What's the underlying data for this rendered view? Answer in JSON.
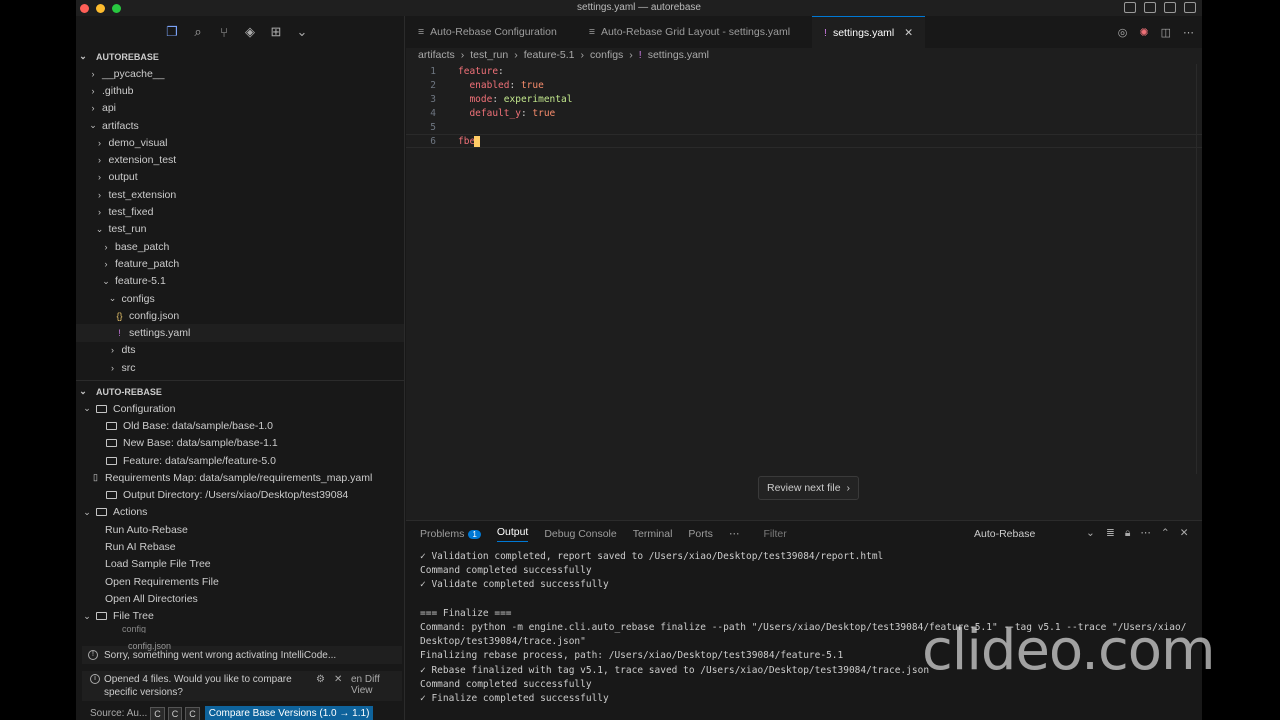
{
  "window": {
    "title": "settings.yaml — autorebase"
  },
  "explorer": {
    "section_title": "AUTOREBASE",
    "tree": [
      {
        "label": "__pycache__",
        "depth": 0,
        "type": "folder",
        "open": false
      },
      {
        "label": ".github",
        "depth": 0,
        "type": "folder",
        "open": false
      },
      {
        "label": "api",
        "depth": 0,
        "type": "folder",
        "open": false
      },
      {
        "label": "artifacts",
        "depth": 0,
        "type": "folder",
        "open": true
      },
      {
        "label": "demo_visual",
        "depth": 1,
        "type": "folder",
        "open": false
      },
      {
        "label": "extension_test",
        "depth": 1,
        "type": "folder",
        "open": false
      },
      {
        "label": "output",
        "depth": 1,
        "type": "folder",
        "open": false
      },
      {
        "label": "test_extension",
        "depth": 1,
        "type": "folder",
        "open": false
      },
      {
        "label": "test_fixed",
        "depth": 1,
        "type": "folder",
        "open": false
      },
      {
        "label": "test_run",
        "depth": 1,
        "type": "folder",
        "open": true
      },
      {
        "label": "base_patch",
        "depth": 2,
        "type": "folder",
        "open": false
      },
      {
        "label": "feature_patch",
        "depth": 2,
        "type": "folder",
        "open": false
      },
      {
        "label": "feature-5.1",
        "depth": 2,
        "type": "folder",
        "open": true
      },
      {
        "label": "configs",
        "depth": 3,
        "type": "folder",
        "open": true
      },
      {
        "label": "config.json",
        "depth": 4,
        "type": "json"
      },
      {
        "label": "settings.yaml",
        "depth": 4,
        "type": "yaml"
      },
      {
        "label": "dts",
        "depth": 3,
        "type": "folder",
        "open": false
      },
      {
        "label": "src",
        "depth": 3,
        "type": "folder",
        "open": false
      }
    ]
  },
  "auto_rebase": {
    "section_title": "AUTO-REBASE",
    "configuration_label": "Configuration",
    "config_items": [
      "Old Base: data/sample/base-1.0",
      "New Base: data/sample/base-1.1",
      "Feature: data/sample/feature-5.0"
    ],
    "requirements_map": "Requirements Map: data/sample/requirements_map.yaml",
    "output_directory": "Output Directory: /Users/xiao/Desktop/test39084",
    "actions_label": "Actions",
    "actions": [
      "Run Auto-Rebase",
      "Run AI Rebase",
      "Load Sample File Tree",
      "Open Requirements File",
      "Open All Directories"
    ],
    "file_tree_label": "File Tree",
    "file_tree_child": "config",
    "file_tree_child2": "config.json"
  },
  "notifications": {
    "error_text": "Sorry, something went wrong activating IntelliCode...",
    "info_text": "Opened 4 files. Would you like to compare specific versions?",
    "diff_view": "en Diff View",
    "source_label": "Source: Au...",
    "pills": [
      "C",
      "C",
      "C"
    ],
    "primary_button": "Compare Base Versions (1.0 → 1.1)"
  },
  "editor": {
    "tabs": [
      {
        "label": "Auto-Rebase Configuration",
        "active": false
      },
      {
        "label": "Auto-Rebase Grid Layout - settings.yaml",
        "active": false
      },
      {
        "label": "settings.yaml",
        "active": true
      }
    ],
    "breadcrumb": [
      "artifacts",
      "test_run",
      "feature-5.1",
      "configs",
      "settings.yaml"
    ],
    "lines": [
      {
        "n": "1",
        "key": "feature",
        "val": "",
        "indent": ""
      },
      {
        "n": "2",
        "key": "enabled",
        "val": "true",
        "indent": "  "
      },
      {
        "n": "3",
        "key": "mode",
        "val": "experimental",
        "indent": "  "
      },
      {
        "n": "4",
        "key": "default_y",
        "val": "true",
        "indent": "  "
      },
      {
        "n": "5",
        "key": "",
        "val": "",
        "indent": ""
      },
      {
        "n": "6",
        "key": "fbe",
        "val": "",
        "indent": ""
      }
    ],
    "review_button": "Review next file"
  },
  "panel": {
    "tabs": [
      "Problems",
      "Output",
      "Debug Console",
      "Terminal",
      "Ports"
    ],
    "problems_count": "1",
    "active_tab": "Output",
    "filter_placeholder": "Filter",
    "channel": "Auto-Rebase",
    "output_lines": [
      "✓ Validation completed, report saved to /Users/xiao/Desktop/test39084/report.html",
      "Command completed successfully",
      "✓ Validate completed successfully",
      "",
      "=== Finalize ===",
      "Command: python -m engine.cli.auto_rebase finalize --path \"/Users/xiao/Desktop/test39084/feature-5.1\" --tag v5.1 --trace \"/Users/xiao/",
      "Desktop/test39084/trace.json\"",
      "Finalizing rebase process, path: /Users/xiao/Desktop/test39084/feature-5.1",
      "✓ Rebase finalized with tag v5.1, trace saved to /Users/xiao/Desktop/test39084/trace.json",
      "Command completed successfully",
      "✓ Finalize completed successfully"
    ]
  },
  "watermark": "clideo.com"
}
